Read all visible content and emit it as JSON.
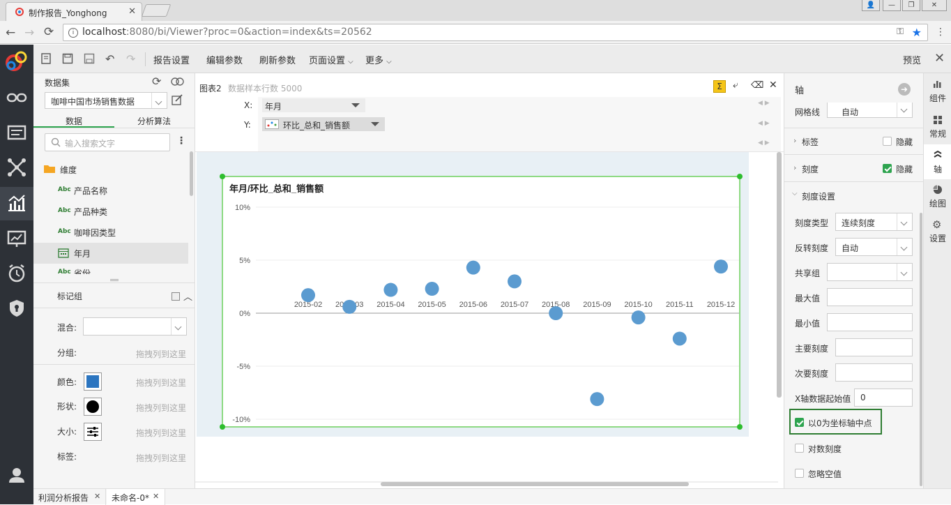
{
  "browser": {
    "tab_title": "制作报告_Yonghong",
    "url_host": "localhost",
    "url_rest": ":8080/bi/Viewer?proc=0&action=index&ts=20562"
  },
  "toolbar": {
    "report_settings": "报告设置",
    "edit_params": "编辑参数",
    "refresh_params": "刷新参数",
    "page_settings": "页面设置",
    "more": "更多",
    "preview": "预览"
  },
  "dataset_panel": {
    "title": "数据集",
    "dataset_value": "咖啡中国市场销售数据",
    "tab_data": "数据",
    "tab_algo": "分析算法",
    "search_placeholder": "输入搜索文字",
    "tree": {
      "folder": "维度",
      "items": [
        "产品名称",
        "产品种类",
        "咖啡因类型",
        "年月",
        "省份"
      ]
    }
  },
  "marks": {
    "title": "标记组",
    "mix_label": "混合:",
    "group_label": "分组:",
    "color_label": "颜色:",
    "shape_label": "形状:",
    "size_label": "大小:",
    "tag_label": "标签:",
    "drop_hint": "拖拽列到这里",
    "color_swatch": "#2b75c0"
  },
  "chart_header": {
    "name": "图表2",
    "sample_rows": "数据样本行数 5000",
    "x_label": "X:",
    "x_field": "年月",
    "y_label": "Y:",
    "y_field": "环比_总和_销售额"
  },
  "chart_data": {
    "type": "scatter",
    "title": "年月/环比_总和_销售额",
    "categories": [
      "2015-02",
      "2015-03",
      "2015-04",
      "2015-05",
      "2015-06",
      "2015-07",
      "2015-08",
      "2015-09",
      "2015-10",
      "2015-11",
      "2015-12"
    ],
    "values": [
      1.7,
      0.6,
      2.2,
      2.3,
      4.3,
      3.0,
      -0.0,
      -8.1,
      -0.4,
      -2.4,
      4.4
    ],
    "ylim": [
      -10,
      10
    ],
    "yticks": [
      "10%",
      "5%",
      "0%",
      "-5%",
      "-10%"
    ],
    "ytick_values": [
      10,
      5,
      0,
      -5,
      -10
    ],
    "point_color": "#5b9bd0",
    "grid": true
  },
  "right_panel": {
    "section_title": "轴",
    "gridline_label": "网格线",
    "gridline_value": "自动",
    "label_section": "标签",
    "label_hide": "隐藏",
    "tick_section": "刻度",
    "tick_hide": "隐藏",
    "tick_settings": "刻度设置",
    "tick_type_label": "刻度类型",
    "tick_type_value": "连续刻度",
    "reverse_label": "反转刻度",
    "reverse_value": "自动",
    "share_label": "共享组",
    "max_label": "最大值",
    "min_label": "最小值",
    "major_label": "主要刻度",
    "minor_label": "次要刻度",
    "xstart_label": "X轴数据起始值",
    "xstart_value": "0",
    "zero_center": "以0为坐标轴中点",
    "log_scale": "对数刻度",
    "ignore_null": "忽略空值"
  },
  "side_tabs": [
    "组件",
    "常规",
    "轴",
    "绘图",
    "设置"
  ],
  "bottom_tabs": [
    "利润分析报告",
    "未命名-0*"
  ]
}
